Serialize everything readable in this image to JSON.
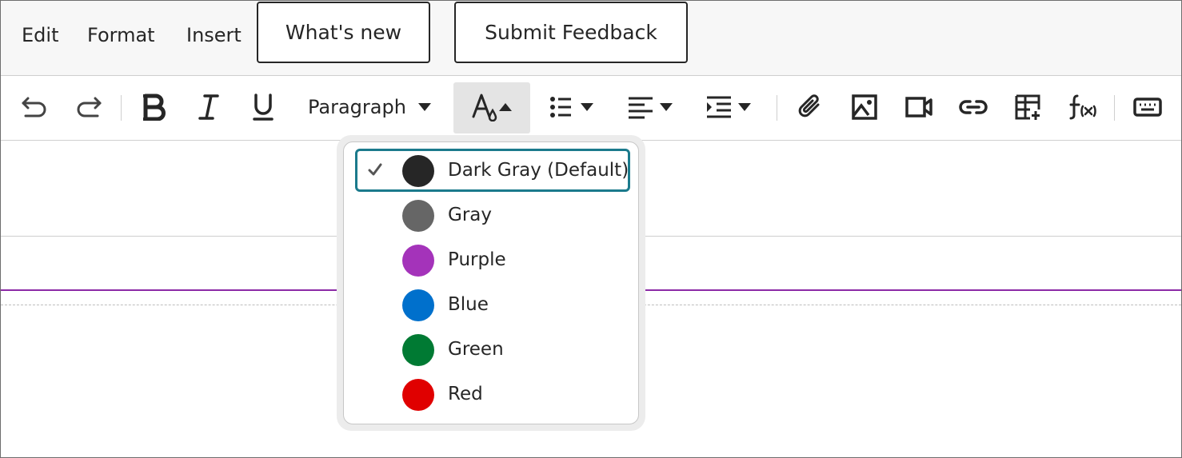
{
  "menubar": {
    "edit": "Edit",
    "format": "Format",
    "insert": "Insert",
    "whats_new": "What's new",
    "submit_feedback": "Submit Feedback"
  },
  "toolbar": {
    "paragraph": "Paragraph",
    "icons": [
      "undo-icon",
      "redo-icon",
      "bold-icon",
      "italic-icon",
      "underline-icon",
      "text-color-icon",
      "bullet-list-icon",
      "align-left-icon",
      "indent-icon",
      "attachment-icon",
      "image-icon",
      "video-icon",
      "link-icon",
      "table-icon",
      "formula-icon",
      "keyboard-icon"
    ]
  },
  "color_menu": {
    "selected": "Dark Gray (Default)",
    "options": [
      {
        "label": "Dark Gray (Default)",
        "color": "#262626"
      },
      {
        "label": "Gray",
        "color": "#666666"
      },
      {
        "label": "Purple",
        "color": "#a433ba"
      },
      {
        "label": "Blue",
        "color": "#0070cc"
      },
      {
        "label": "Green",
        "color": "#007a33"
      },
      {
        "label": "Red",
        "color": "#e00000"
      }
    ]
  },
  "colors": {
    "focus_ring": "#1b7a8c",
    "editor_accent": "#8c2aa6"
  }
}
